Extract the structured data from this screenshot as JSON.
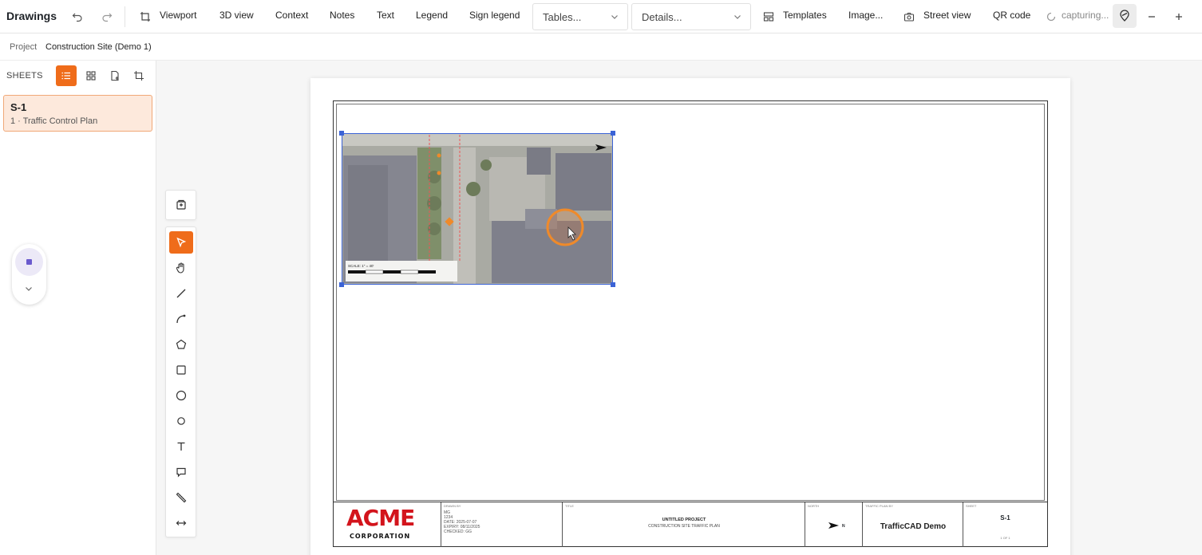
{
  "app": {
    "title": "Drawings"
  },
  "toolbar": {
    "items": [
      "Viewport",
      "3D view",
      "Context",
      "Notes",
      "Text",
      "Legend",
      "Sign legend"
    ],
    "tables_dropdown": "Tables...",
    "details_dropdown": "Details...",
    "templates_label": "Templates",
    "image_label": "Image...",
    "street_view_label": "Street view",
    "qr_code_label": "QR code",
    "capturing_label": "capturing..."
  },
  "project": {
    "label": "Project",
    "name": "Construction Site (Demo 1)"
  },
  "sidebar": {
    "sheets_label": "SHEETS",
    "sheets": [
      {
        "code": "S-1",
        "name": "1 · Traffic Control Plan"
      }
    ]
  },
  "sheet": {
    "scale_label": "SCALE: 1\" = 40'",
    "titleblock": {
      "logo_line1": "ACME",
      "logo_line2": "CORPORATION",
      "drawn_by_caption": "DRAWN BY",
      "drawn_lines": [
        "MG",
        "1234",
        "DATE: 2025-07-07",
        "EXPIRY: 08/11/2025",
        "CHECKED: GG"
      ],
      "title_caption": "TITLE",
      "title_line1": "UNTITLED PROJECT",
      "title_line2": "CONSTRUCTION SITE TRAFFIC PLAN",
      "north_caption": "NORTH",
      "north_letter": "N",
      "plan_caption": "TRAFFIC PLAN BY",
      "company": "TrafficCAD Demo",
      "sheet_caption": "SHEET",
      "sheet_code": "S-1",
      "sheet_of": "1 OF 1"
    }
  },
  "colors": {
    "accent": "#ef6c1a",
    "selection": "#3b63d6",
    "aerial_roof": "#8a8c96"
  }
}
